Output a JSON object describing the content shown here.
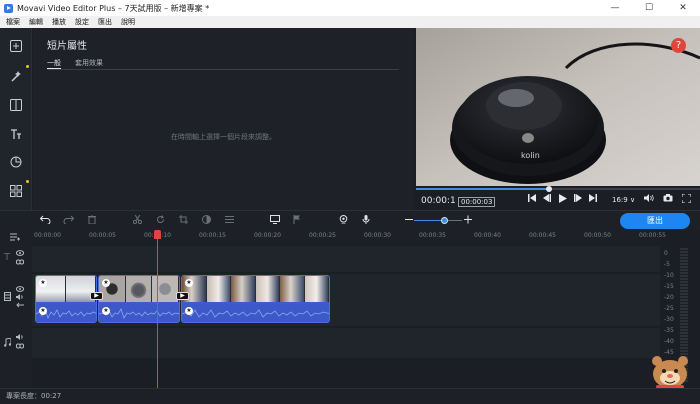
{
  "window": {
    "title": "Movavi Video Editor Plus – 7天試用版 – 新增專案 *",
    "controls": [
      "—",
      "☐",
      "✕"
    ]
  },
  "menu": [
    "檔案",
    "編輯",
    "播放",
    "設定",
    "匯出",
    "說明"
  ],
  "tools": [
    "import-icon",
    "magic-wand-icon",
    "transition-icon",
    "titles-icon",
    "filters-icon",
    "more-tools-icon"
  ],
  "panel": {
    "title": "短片屬性",
    "tabs": [
      "一般",
      "套用效果"
    ],
    "hint": "在時間軸上選擇一個片段來調整。"
  },
  "preview": {
    "help": "?",
    "progress": 0.47,
    "timecode": "00:00:1",
    "timecode_tip": "00:00:03",
    "aspect_ratio": "16:9 ∨",
    "product_brand": "kolin"
  },
  "toolbar": {
    "export_label": "匯出"
  },
  "ruler": [
    "00:00:00",
    "00:00:05",
    "00:00:10",
    "00:00:15",
    "00:00:20",
    "00:00:25",
    "00:00:30",
    "00:00:35",
    "00:00:40",
    "00:00:45",
    "00:00:50",
    "00:00:55"
  ],
  "meter": [
    "0",
    "-5",
    "-10",
    "-15",
    "-20",
    "-25",
    "-30",
    "-35",
    "-40",
    "-45",
    "-50"
  ],
  "status": {
    "project_length": "專案長度：00:27"
  },
  "colors": {
    "accent": "#1d86f0",
    "playhead": "#e0453b",
    "clip": "#3b5bd1"
  }
}
